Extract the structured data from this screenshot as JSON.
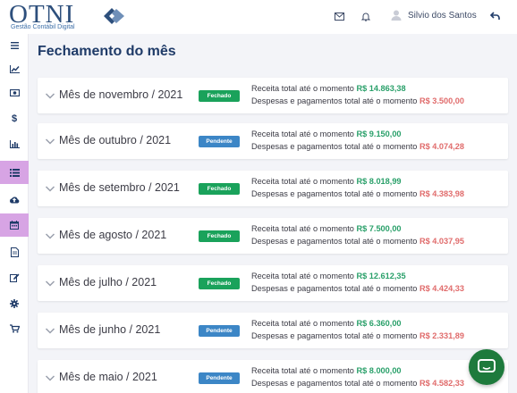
{
  "brand": {
    "name": "OTNI",
    "tagline": "Gestão Contábil Digital"
  },
  "header": {
    "user_name": "Silvio dos Santos",
    "icons": [
      "mail-icon",
      "bell-icon",
      "user-icon",
      "logout-icon"
    ]
  },
  "sidebar": {
    "items": [
      {
        "icon": "menu-icon",
        "active": false
      },
      {
        "icon": "chart-line-icon",
        "active": false
      },
      {
        "icon": "money-icon",
        "active": false
      },
      {
        "icon": "dollar-icon",
        "active": false
      },
      {
        "icon": "bar-chart-icon",
        "active": false
      },
      {
        "icon": "list-icon",
        "active": true
      },
      {
        "icon": "cloud-upload-icon",
        "active": false
      },
      {
        "icon": "calendar-icon",
        "active": true
      },
      {
        "icon": "document-icon",
        "active": false
      },
      {
        "icon": "edit-icon",
        "active": false
      },
      {
        "icon": "gear-icon",
        "active": false
      },
      {
        "icon": "cart-icon",
        "active": false
      }
    ]
  },
  "page": {
    "title": "Fechamento do mês"
  },
  "labels": {
    "revenue": "Receita total até o momento",
    "expenses": "Despesas e pagamentos total até o momento"
  },
  "colors": {
    "closed": "#1aa25b",
    "pending": "#3c86c6",
    "positive": "#2aa06a",
    "negative": "#e06b6b",
    "title": "#1f3b68"
  },
  "months": [
    {
      "label": "Mês de novembro / 2021",
      "status": "Fechado",
      "revenue": "R$ 14.863,38",
      "expenses": "R$ 3.500,00"
    },
    {
      "label": "Mês de outubro / 2021",
      "status": "Pendente",
      "revenue": "R$ 9.150,00",
      "expenses": "R$ 4.074,28"
    },
    {
      "label": "Mês de setembro / 2021",
      "status": "Fechado",
      "revenue": "R$ 8.018,99",
      "expenses": "R$ 4.383,98"
    },
    {
      "label": "Mês de agosto / 2021",
      "status": "Fechado",
      "revenue": "R$ 7.500,00",
      "expenses": "R$ 4.037,95"
    },
    {
      "label": "Mês de julho / 2021",
      "status": "Fechado",
      "revenue": "R$ 12.612,35",
      "expenses": "R$ 4.424,33"
    },
    {
      "label": "Mês de junho / 2021",
      "status": "Pendente",
      "revenue": "R$ 6.360,00",
      "expenses": "R$ 2.331,89"
    },
    {
      "label": "Mês de maio / 2021",
      "status": "Pendente",
      "revenue": "R$ 8.000,00",
      "expenses": "R$ 4.582,33"
    }
  ],
  "chat": {
    "icon": "chat-icon"
  }
}
